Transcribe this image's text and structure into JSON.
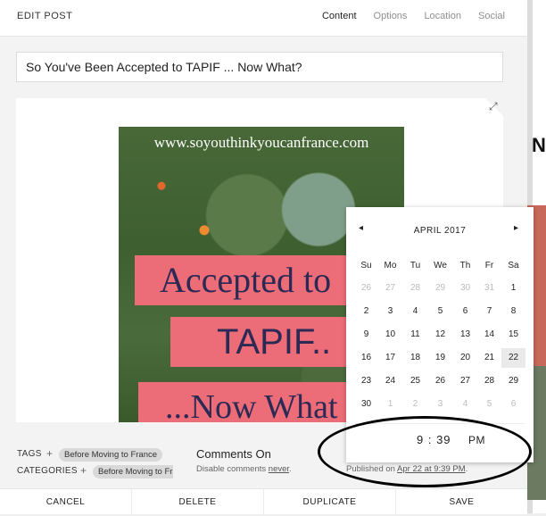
{
  "header": {
    "title": "EDIT POST",
    "tabs": [
      {
        "label": "Content",
        "active": true
      },
      {
        "label": "Options",
        "active": false
      },
      {
        "label": "Location",
        "active": false
      },
      {
        "label": "Social",
        "active": false
      }
    ]
  },
  "post": {
    "title": "So You've Been Accepted to TAPIF ... Now What?"
  },
  "image": {
    "url_text": "www.soyouthinkyoucanfrance.com",
    "line1": "Accepted to",
    "line2": "TAPIF..",
    "line3": "...Now What"
  },
  "meta": {
    "tags_label": "TAGS",
    "tag_chip": "Before Moving to France",
    "categories_label": "CATEGORIES",
    "category_chip": "Before Moving to France",
    "comments_title": "Comments On",
    "comments_prefix": "Disable comments ",
    "comments_link": "never",
    "comments_suffix": ".",
    "published_prefix": "Published on ",
    "published_link": "Apr 22 at 9:39 PM",
    "published_suffix": "."
  },
  "calendar": {
    "month": "APRIL 2017",
    "prev": "◂",
    "next": "▸",
    "weekdays": [
      "Su",
      "Mo",
      "Tu",
      "We",
      "Th",
      "Fr",
      "Sa"
    ],
    "weeks": [
      [
        "26",
        "27",
        "28",
        "29",
        "30",
        "31",
        "1"
      ],
      [
        "2",
        "3",
        "4",
        "5",
        "6",
        "7",
        "8"
      ],
      [
        "9",
        "10",
        "11",
        "12",
        "13",
        "14",
        "15"
      ],
      [
        "16",
        "17",
        "18",
        "19",
        "20",
        "21",
        "22"
      ],
      [
        "23",
        "24",
        "25",
        "26",
        "27",
        "28",
        "29"
      ],
      [
        "30",
        "1",
        "2",
        "3",
        "4",
        "5",
        "6"
      ]
    ],
    "selected_day": "22",
    "time": "9 : 39",
    "ampm": "PM"
  },
  "footer": {
    "buttons": [
      "CANCEL",
      "DELETE",
      "DUPLICATE",
      "SAVE"
    ]
  },
  "background": {
    "letter": "N"
  }
}
